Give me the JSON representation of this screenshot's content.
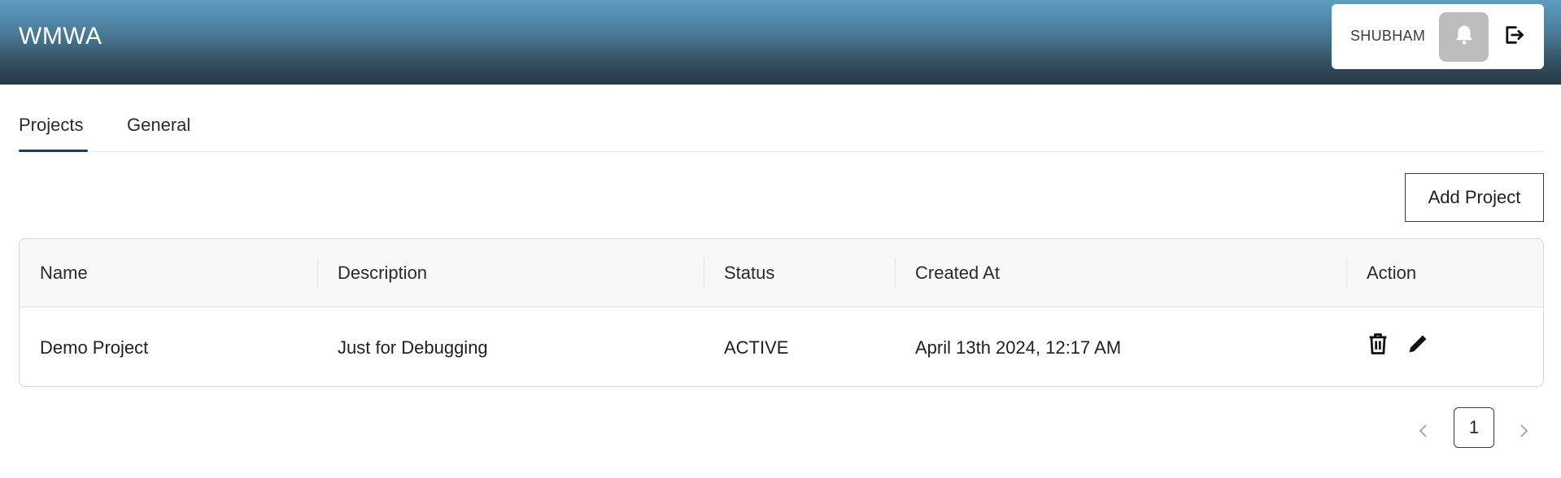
{
  "app": {
    "title": "WMWA"
  },
  "user": {
    "name": "SHUBHAM",
    "bell_icon": "bell-icon",
    "logout_icon": "logout-icon"
  },
  "tabs": [
    {
      "label": "Projects",
      "active": true
    },
    {
      "label": "General",
      "active": false
    }
  ],
  "toolbar": {
    "add_label": "Add Project"
  },
  "table": {
    "columns": [
      "Name",
      "Description",
      "Status",
      "Created At",
      "Action"
    ],
    "rows": [
      {
        "name": "Demo Project",
        "description": "Just for Debugging",
        "status": "ACTIVE",
        "created_at": "April 13th 2024, 12:17 AM",
        "actions": [
          "trash-icon",
          "pencil-icon"
        ]
      }
    ]
  },
  "pagination": {
    "current_page": "1",
    "prev_icon": "chevron-left-icon",
    "next_icon": "chevron-right-icon"
  },
  "colors": {
    "header_top": "#5e9cbf",
    "header_bottom": "#253744",
    "tab_underline": "#1f3b4d",
    "bell_bg": "#bdbdbd"
  }
}
